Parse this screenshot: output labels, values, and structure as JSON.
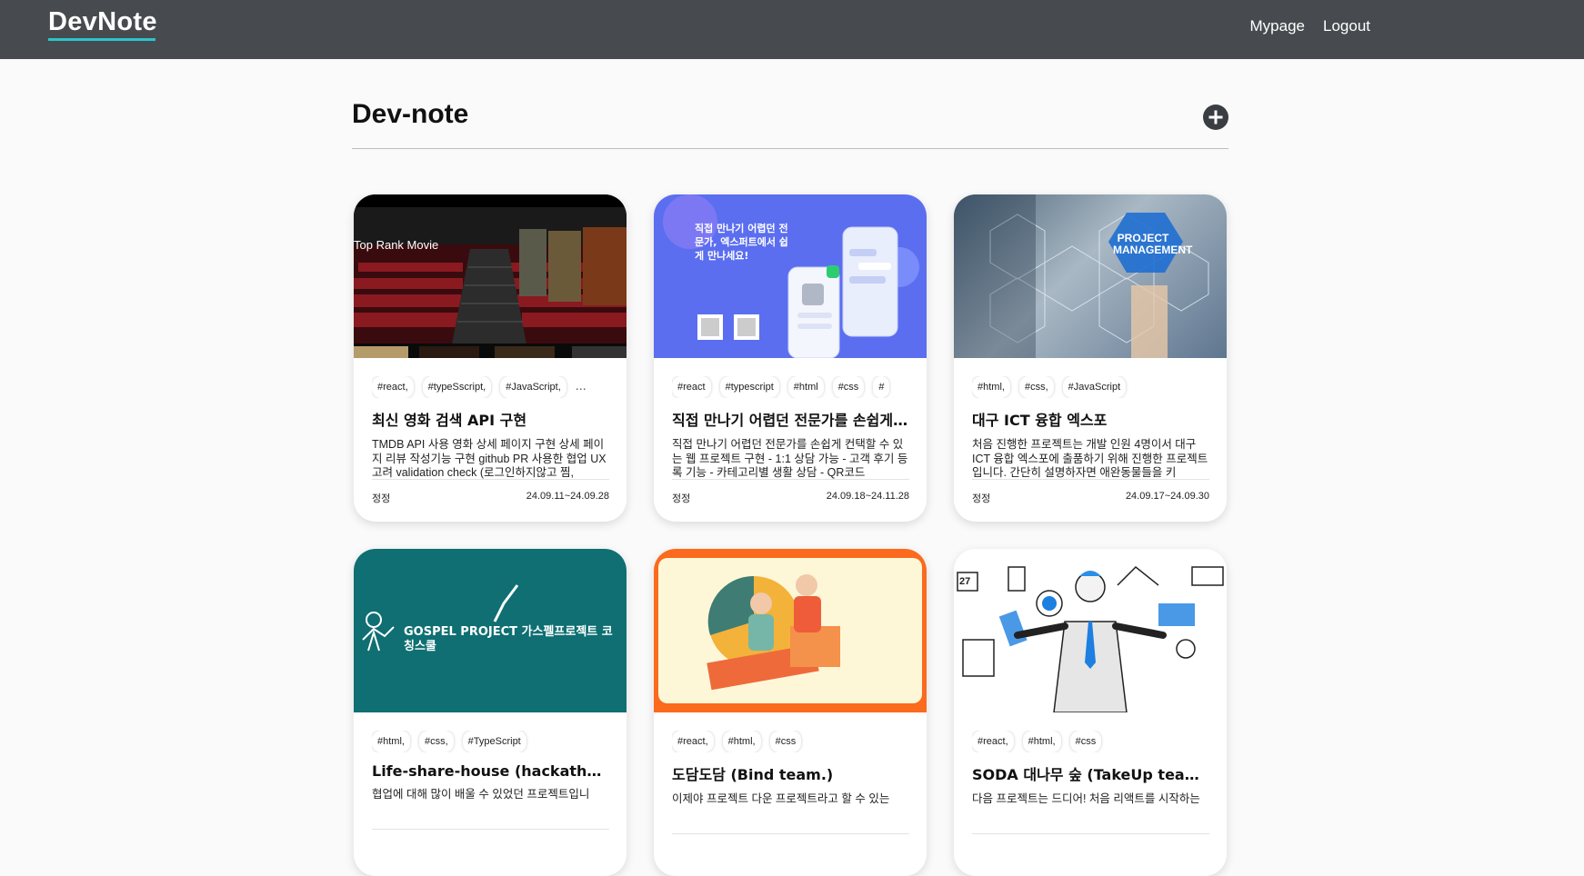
{
  "nav": {
    "logo": "DevNote",
    "links": [
      "Mypage",
      "Logout"
    ]
  },
  "page": {
    "title": "Dev-note"
  },
  "cards": [
    {
      "thumb_text": "Top Rank Movie",
      "tags": [
        "#react,",
        "#typeSscript,",
        "#JavaScript,"
      ],
      "more": "…",
      "title": "최신 영화 검색 API 구현",
      "desc": "TMDB API 사용 영화 상세 페이지 구현 상세 페이지 리뷰 작성기능 구현 github PR 사용한 협업 UX 고려 validation check (로그인하지않고 찜,",
      "author": "정정",
      "date": "24.09.11~24.09.28"
    },
    {
      "thumb_text": "직접 만나기 어렵던 전문가, 엑스퍼트에서 쉽게 만나세요!",
      "tags": [
        "#react",
        "#typescript",
        "#html",
        "#css",
        "#"
      ],
      "more": "",
      "title": "직접 만나기 어렵던 전문가를 손쉽게 컨택할 수 있는",
      "desc": "직접 만나기 어렵던 전문가를 손쉽게 컨택할 수 있는 웹 프로젝트 구현 - 1:1 상담 가능 - 고객 후기 등록 기능 - 카테고리별 생활 상담 - QR코드",
      "author": "정정",
      "date": "24.09.18~24.11.28"
    },
    {
      "thumb_text": "PROJECT MANAGEMENT",
      "tags": [
        "#html,",
        "#css,",
        "#JavaScript"
      ],
      "more": "",
      "title": "대구 ICT 융합 엑스포",
      "desc": "처음 진행한 프로젝트는 개발 인원 4명이서 대구 ICT 융합 엑스포에 출품하기 위해 진행한 프로젝트입니다. 간단히 설명하자면 애완동물들을 키",
      "author": "정정",
      "date": "24.09.17~24.09.30"
    },
    {
      "thumb_text": "GOSPEL PROJECT 가스펠프로젝트 코칭스쿨",
      "tags": [
        "#html,",
        "#css,",
        "#TypeScript"
      ],
      "more": "",
      "title": "Life-share-house (hackathon)",
      "desc": "협업에 대해 많이 배울 수 있었던 프로젝트입니",
      "author": "",
      "date": ""
    },
    {
      "thumb_text": "",
      "tags": [
        "#react,",
        "#html,",
        "#css"
      ],
      "more": "",
      "title": "도담도담 (Bind team.)",
      "desc": "이제야 프로젝트 다운 프로젝트라고 할 수 있는",
      "author": "",
      "date": ""
    },
    {
      "thumb_text": "27",
      "tags": [
        "#react,",
        "#html,",
        "#css"
      ],
      "more": "",
      "title": "SODA 대나무 숲 (TakeUp team.)",
      "desc": "다음 프로젝트는 드디어! 처음 리액트를 시작하는",
      "author": "",
      "date": ""
    }
  ]
}
